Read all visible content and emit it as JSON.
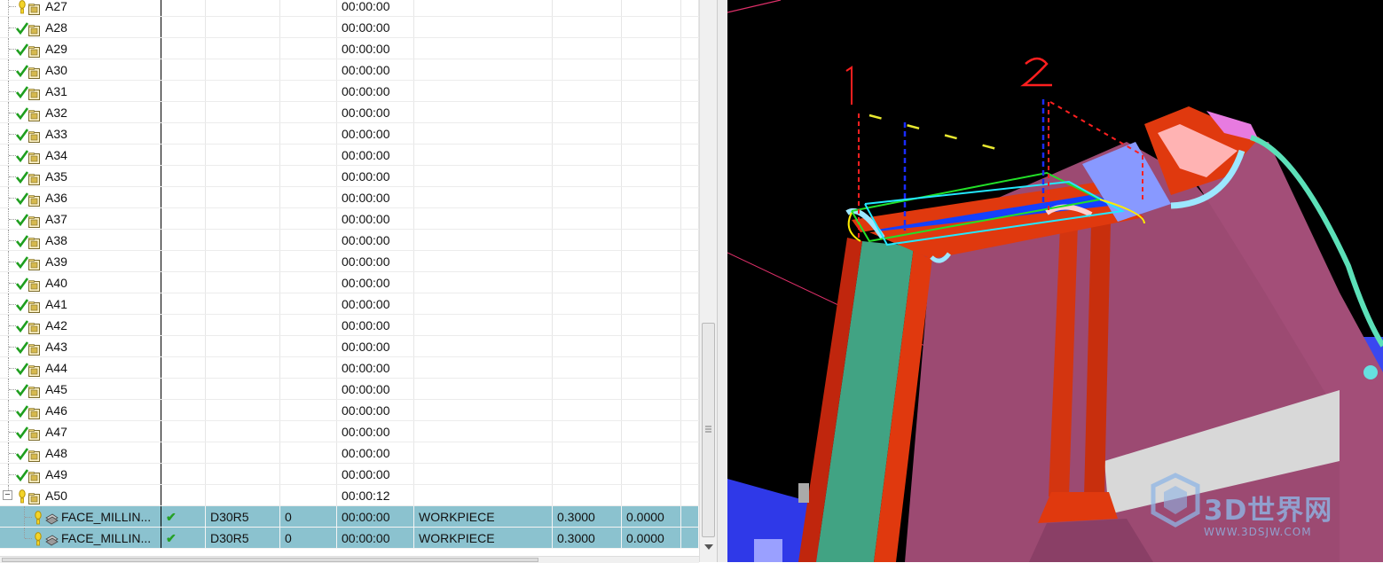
{
  "operations": [
    {
      "name": "A27",
      "status": "warn",
      "time": "00:00:00"
    },
    {
      "name": "A28",
      "status": "ok",
      "time": "00:00:00"
    },
    {
      "name": "A29",
      "status": "ok",
      "time": "00:00:00"
    },
    {
      "name": "A30",
      "status": "ok",
      "time": "00:00:00"
    },
    {
      "name": "A31",
      "status": "ok",
      "time": "00:00:00"
    },
    {
      "name": "A32",
      "status": "ok",
      "time": "00:00:00"
    },
    {
      "name": "A33",
      "status": "ok",
      "time": "00:00:00"
    },
    {
      "name": "A34",
      "status": "ok",
      "time": "00:00:00"
    },
    {
      "name": "A35",
      "status": "ok",
      "time": "00:00:00"
    },
    {
      "name": "A36",
      "status": "ok",
      "time": "00:00:00"
    },
    {
      "name": "A37",
      "status": "ok",
      "time": "00:00:00"
    },
    {
      "name": "A38",
      "status": "ok",
      "time": "00:00:00"
    },
    {
      "name": "A39",
      "status": "ok",
      "time": "00:00:00"
    },
    {
      "name": "A40",
      "status": "ok",
      "time": "00:00:00"
    },
    {
      "name": "A41",
      "status": "ok",
      "time": "00:00:00"
    },
    {
      "name": "A42",
      "status": "ok",
      "time": "00:00:00"
    },
    {
      "name": "A43",
      "status": "ok",
      "time": "00:00:00"
    },
    {
      "name": "A44",
      "status": "ok",
      "time": "00:00:00"
    },
    {
      "name": "A45",
      "status": "ok",
      "time": "00:00:00"
    },
    {
      "name": "A46",
      "status": "ok",
      "time": "00:00:00"
    },
    {
      "name": "A47",
      "status": "ok",
      "time": "00:00:00"
    },
    {
      "name": "A48",
      "status": "ok",
      "time": "00:00:00"
    },
    {
      "name": "A49",
      "status": "ok",
      "time": "00:00:00"
    },
    {
      "name": "A50",
      "status": "warn",
      "time": "00:00:12",
      "expanded": true
    }
  ],
  "children": [
    {
      "name": "FACE_MILLIN...",
      "check": "✔",
      "tool": "D30R5",
      "num": "0",
      "time": "00:00:00",
      "geometry": "WORKPIECE",
      "stock": "0.3000",
      "floor": "0.0000"
    },
    {
      "name": "FACE_MILLIN...",
      "check": "✔",
      "tool": "D30R5",
      "num": "0",
      "time": "00:00:00",
      "geometry": "WORKPIECE",
      "stock": "0.3000",
      "floor": "0.0000"
    }
  ],
  "expand_toggle": "−",
  "viewport": {
    "annotation_1": "1",
    "annotation_2": "2",
    "watermark_main": "3D世界网",
    "watermark_url": "WWW.3DSJW.COM",
    "colors": {
      "background": "#000000",
      "wall_face": "#9c4a72",
      "fillet": "#e0390e",
      "top_face": "#1440ff",
      "side_face": "#41a383"
    }
  }
}
